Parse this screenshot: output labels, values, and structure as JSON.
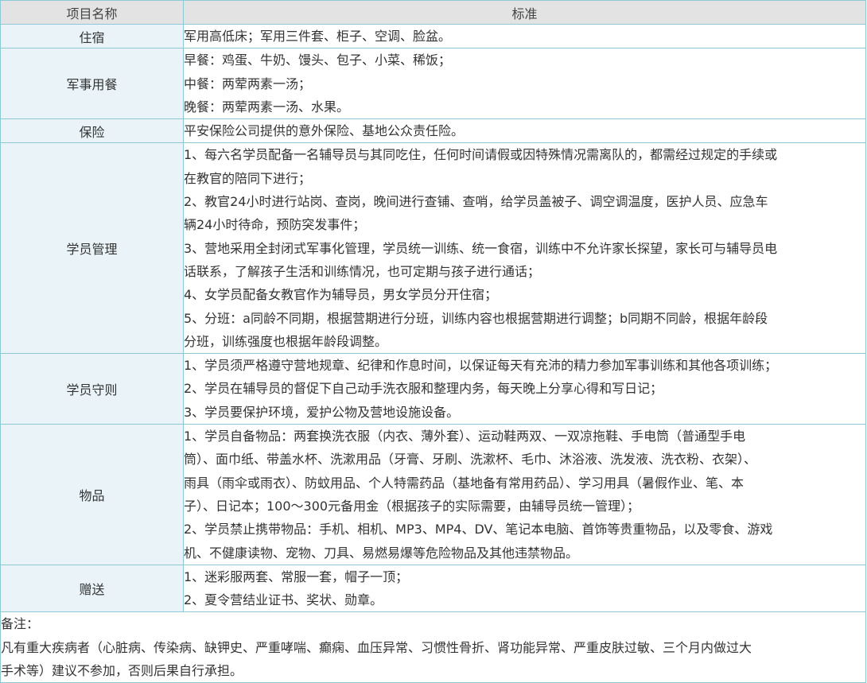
{
  "table": {
    "header": {
      "col1": "项目名称",
      "col2": "标准"
    },
    "rows": [
      {
        "label": "住宿",
        "lines": [
          "军用高低床；军用三件套、柜子、空调、脸盆。"
        ]
      },
      {
        "label": "军事用餐",
        "lines": [
          "早餐：鸡蛋、牛奶、馒头、包子、小菜、稀饭；",
          "中餐：两荤两素一汤；",
          "晚餐：两荤两素一汤、水果。"
        ]
      },
      {
        "label": "保险",
        "lines": [
          "平安保险公司提供的意外保险、基地公众责任险。"
        ]
      },
      {
        "label": "学员管理",
        "lines": [
          "1、每六名学员配备一名辅导员与其同吃住，任何时间请假或因特殊情况需离队的，都需经过规定的手续或",
          "在教官的陪同下进行；",
          "2、教官24小时进行站岗、查岗，晚间进行查铺、查哨，给学员盖被子、调空调温度，医护人员、应急车",
          "辆24小时待命，预防突发事件；",
          "3、营地采用全封闭式军事化管理，学员统一训练、统一食宿，训练中不允许家长探望，家长可与辅导员电",
          "话联系，了解孩子生活和训练情况，也可定期与孩子进行通话；",
          "4、女学员配备女教官作为辅导员，男女学员分开住宿；",
          "5、分班：a同龄不同期，根据营期进行分班，训练内容也根据营期进行调整；b同期不同龄，根据年龄段",
          "分班，训练强度也根据年龄段调整。"
        ]
      },
      {
        "label": "学员守则",
        "lines": [
          "1、学员须严格遵守营地规章、纪律和作息时间，以保证每天有充沛的精力参加军事训练和其他各项训练；",
          "2、学员在辅导员的督促下自己动手洗衣服和整理内务，每天晚上分享心得和写日记；",
          "3、学员要保护环境，爱护公物及营地设施设备。"
        ]
      },
      {
        "label": "物品",
        "lines": [
          "1、学员自备物品：两套换洗衣服（内衣、薄外套）、运动鞋两双、一双凉拖鞋、手电筒（普通型手电",
          "筒）、面巾纸、带盖水杯、洗漱用品（牙膏、牙刷、洗漱杯、毛巾、沐浴液、洗发液、洗衣粉、衣架）、",
          "雨具（雨伞或雨衣）、防蚊用品、个人特需药品（基地备有常用药品）、学习用具（暑假作业、笔、本",
          "子）、日记本；100～300元备用金（根据孩子的实际需要，由辅导员统一管理）；",
          "2、学员禁止携带物品：手机、相机、MP3、MP4、DV、笔记本电脑、首饰等贵重物品，以及零食、游戏",
          "机、不健康读物、宠物、刀具、易燃易爆等危险物品及其他违禁物品。"
        ]
      },
      {
        "label": "赠送",
        "lines": [
          "1、迷彩服两套、常服一套，帽子一顶；",
          "2、夏令营结业证书、奖状、勋章。"
        ]
      }
    ],
    "note": {
      "lines": [
        "备注：",
        "凡有重大疾病者（心脏病、传染病、缺钾史、严重哮喘、癫痫、血压异常、习惯性骨折、肾功能异常、严重皮肤过敏、三个月内做过大",
        "手术等）建议不参加，否则后果自行承担。"
      ]
    }
  },
  "colors": {
    "border": "#8cc8d6",
    "header_bg": "#e3e3e3",
    "label_bg": "#eaf4f8",
    "text": "#333333"
  }
}
